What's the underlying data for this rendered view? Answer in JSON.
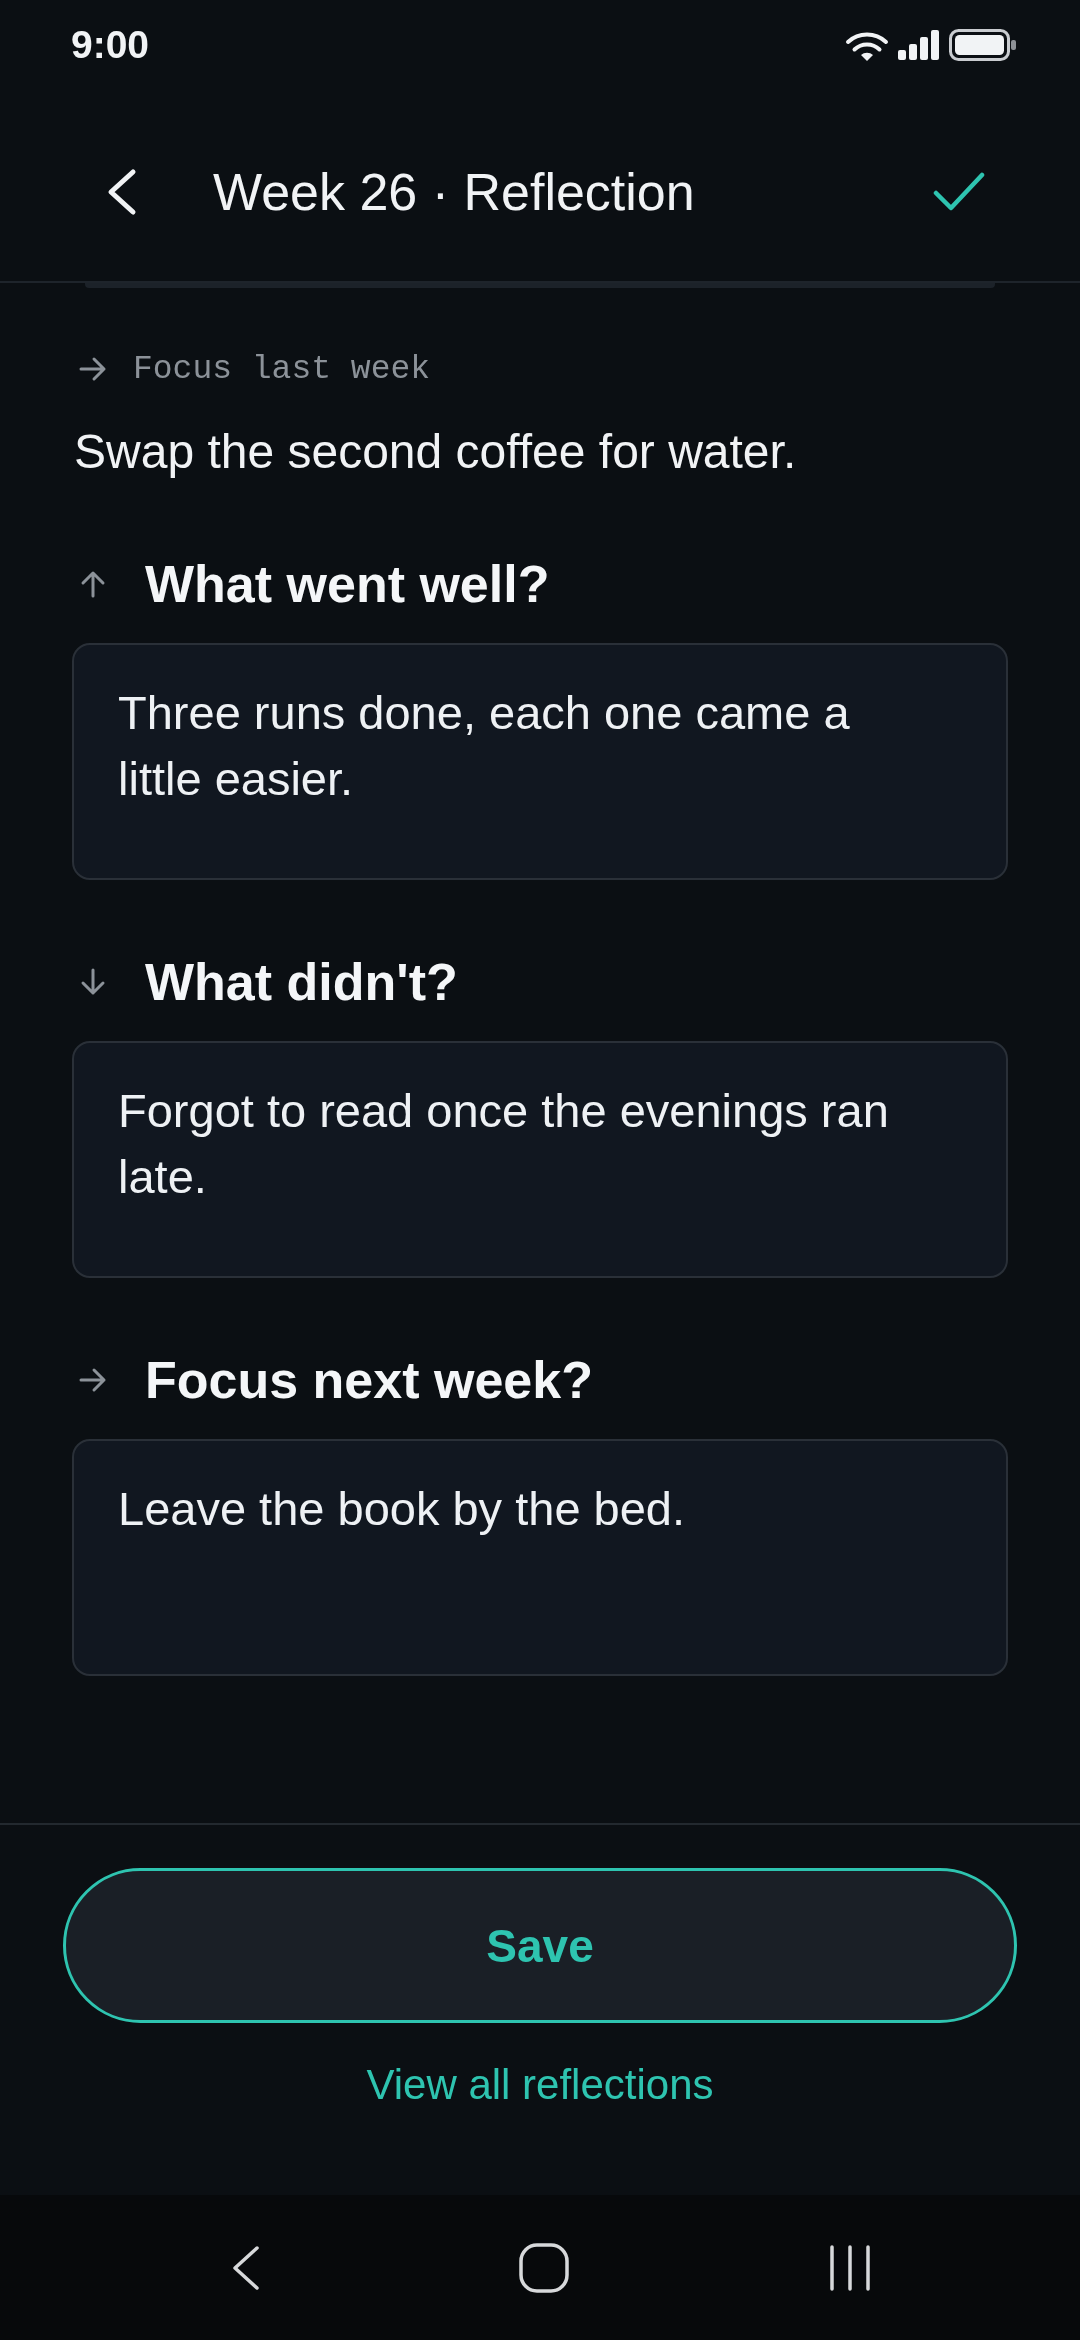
{
  "status_bar": {
    "time": "9:00"
  },
  "header": {
    "title": "Week 26 · Reflection"
  },
  "previous_focus": {
    "label": "Focus last week",
    "text": "Swap the second coffee for water."
  },
  "prompts": [
    {
      "kind": "up",
      "question": "What went well?",
      "answer": "Three runs done, each one came a little easier."
    },
    {
      "kind": "down",
      "question": "What didn't?",
      "answer": "Forgot to read once the evenings ran late."
    },
    {
      "kind": "right",
      "question": "Focus next week?",
      "answer": "Leave the book by the bed."
    }
  ],
  "save_button": {
    "label": "Save"
  },
  "footer_link": {
    "label": "View all reflections"
  }
}
